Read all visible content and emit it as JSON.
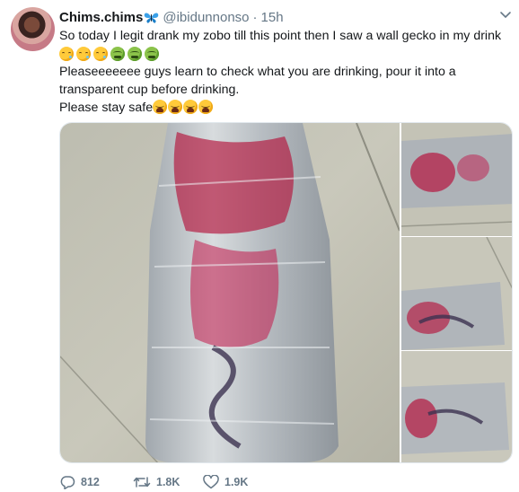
{
  "tweet": {
    "display_name": "Chims.chims",
    "handle": "@ibidunnonso",
    "separator": "·",
    "time": "15h",
    "line1": "So today I legit drank my zobo till this point then I saw a wall gecko in my drink",
    "emoji_row1": [
      "crying-face",
      "crying-face",
      "crying-face",
      "nauseated-face",
      "nauseated-face",
      "nauseated-face"
    ],
    "line2": "Pleaseeeeeee guys learn to check what you are drinking, pour it into a",
    "line3": "transparent cup before drinking.",
    "line4": "Please stay safe",
    "emoji_row2": [
      "weary-face",
      "weary-face",
      "weary-face",
      "weary-face"
    ]
  },
  "actions": {
    "replies": "812",
    "retweets": "1.8K",
    "likes": "1.9K"
  },
  "colors": {
    "text": "#14171a",
    "secondary": "#657786",
    "verified_butterfly": "#1da1f2"
  }
}
